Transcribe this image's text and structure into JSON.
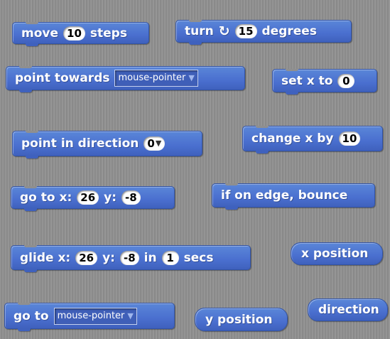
{
  "blocks": {
    "move": {
      "pre": "move",
      "value": "10",
      "post": "steps"
    },
    "turn": {
      "pre": "turn",
      "icon": "turn-clockwise-icon",
      "value": "15",
      "post": "degrees"
    },
    "point_towards": {
      "label": "point towards",
      "dropdown": "mouse-pointer"
    },
    "set_x": {
      "label": "set x to",
      "value": "0"
    },
    "point_direction": {
      "label": "point in direction",
      "value": "0"
    },
    "change_x": {
      "label": "change x by",
      "value": "10"
    },
    "go_to_xy": {
      "pre": "go to x:",
      "x": "26",
      "ymid": "y:",
      "y": "-8"
    },
    "bounce": {
      "label": "if on edge, bounce"
    },
    "glide": {
      "pre": "glide x:",
      "x": "26",
      "ymid": "y:",
      "y": "-8",
      "in": "in",
      "secs_value": "1",
      "post": "secs"
    },
    "x_position": {
      "label": "x position"
    },
    "go_to": {
      "label": "go to",
      "dropdown": "mouse-pointer"
    },
    "y_position": {
      "label": "y position"
    },
    "direction": {
      "label": "direction"
    }
  },
  "colors": {
    "motion": "#4a6fcf",
    "background": "#8f8f8f"
  }
}
